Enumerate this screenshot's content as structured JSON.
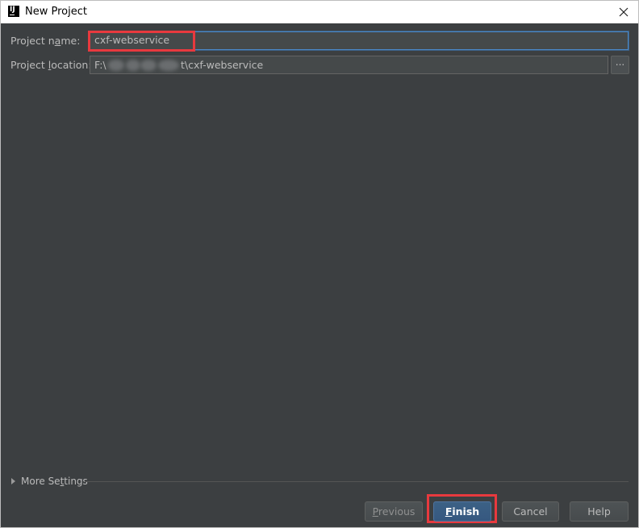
{
  "window": {
    "title": "New Project",
    "app_icon_text": "IJ"
  },
  "form": {
    "project_name": {
      "label_pre": "Project n",
      "label_mnemonic": "a",
      "label_post": "me:",
      "value": "cxf-webservice"
    },
    "project_location": {
      "label_pre": "Project ",
      "label_mnemonic": "l",
      "label_post": "ocation:",
      "value_prefix": "F:\\",
      "value_suffix": "t\\cxf-webservice",
      "browse_label": "..."
    }
  },
  "more_settings": {
    "label_pre": "More Se",
    "label_mnemonic": "t",
    "label_post": "tings"
  },
  "buttons": {
    "previous": {
      "mnemonic": "P",
      "rest": "revious"
    },
    "finish": {
      "mnemonic": "F",
      "rest": "inish"
    },
    "cancel": "Cancel",
    "help": "Help"
  },
  "colors": {
    "panel_bg": "#3c3f41",
    "highlight": "#e8393e",
    "focus_border": "#4a88c7",
    "default_button": "#365880"
  }
}
